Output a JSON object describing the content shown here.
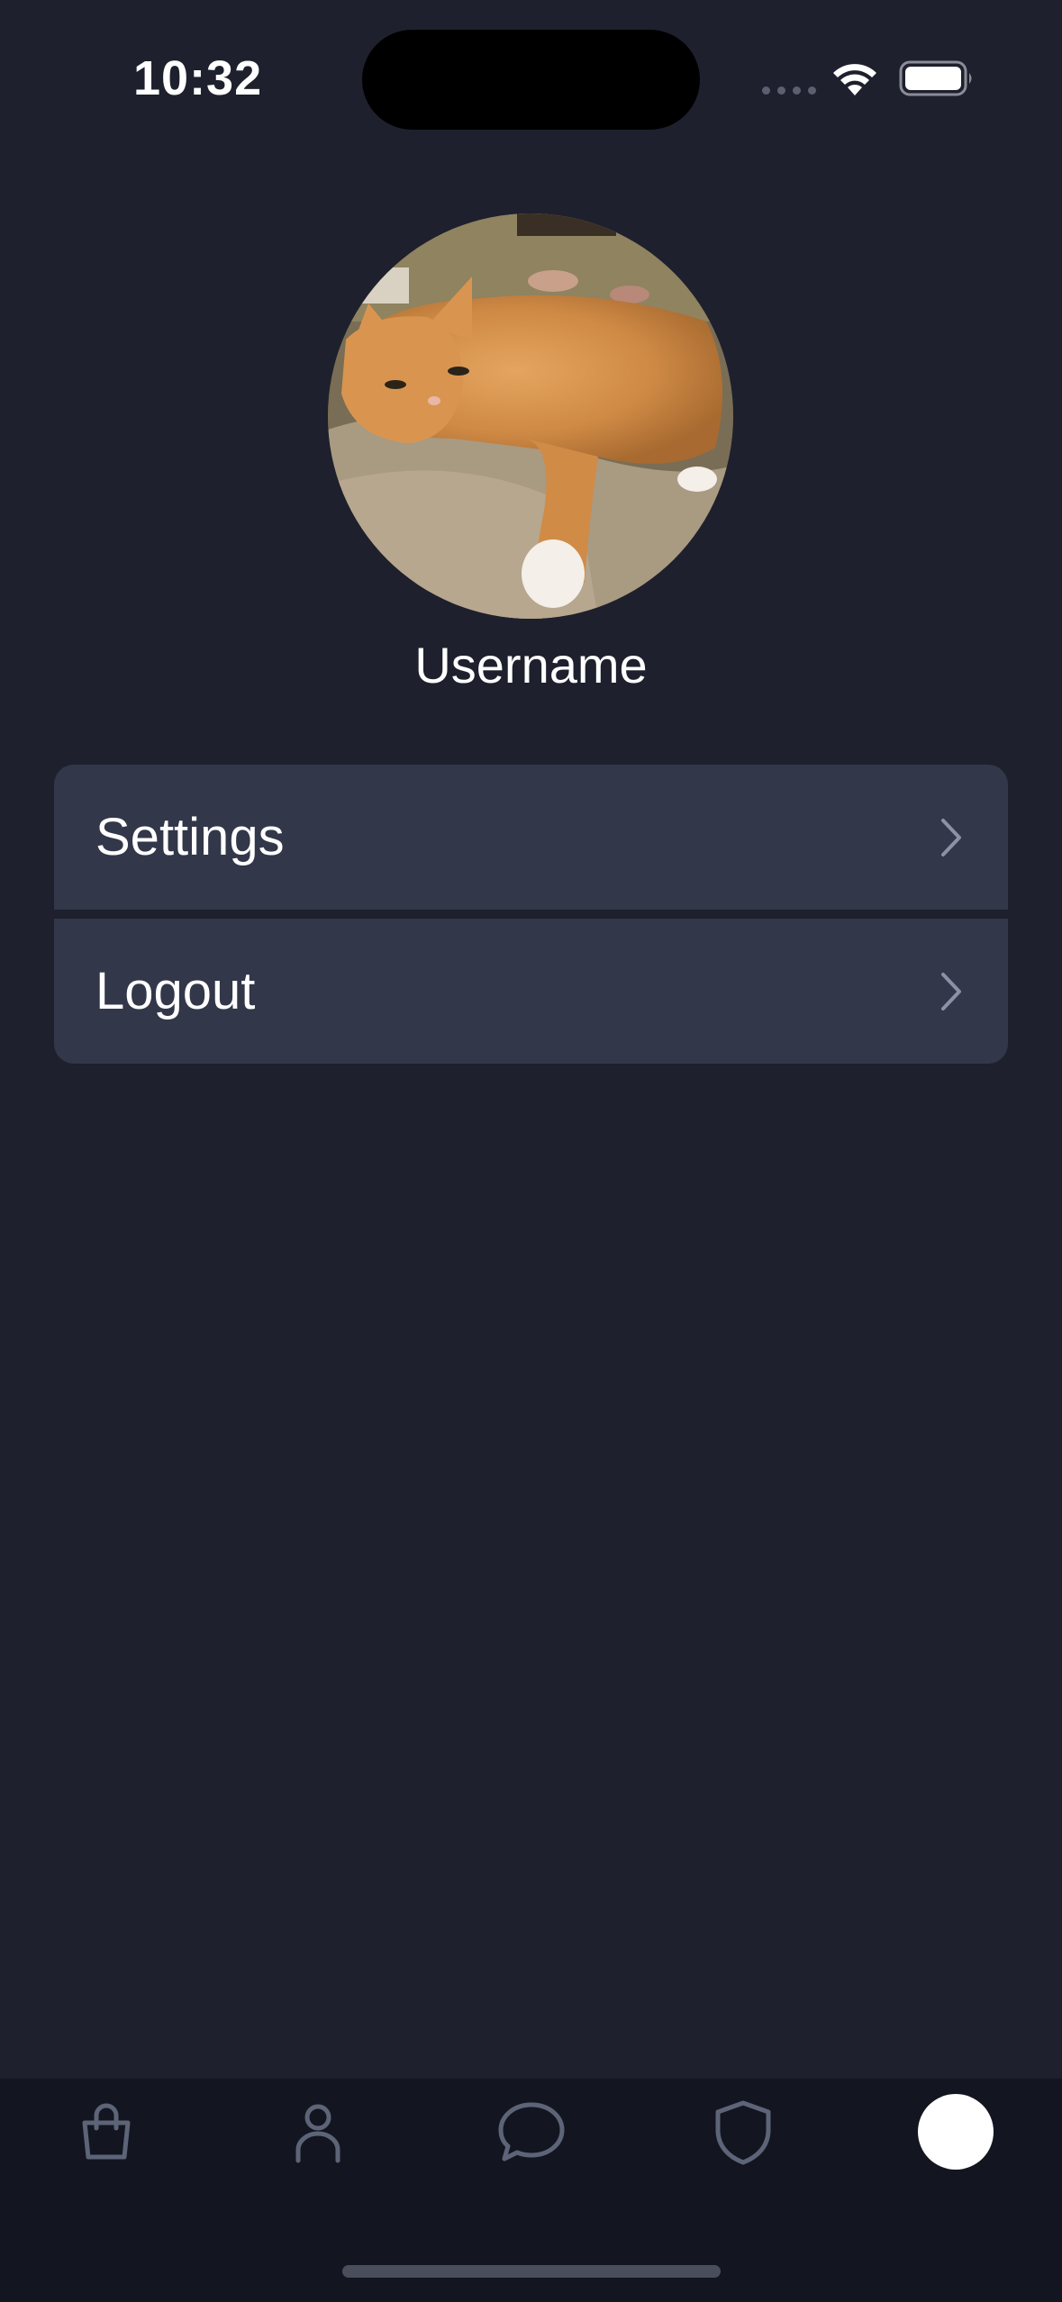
{
  "status_bar": {
    "time": "10:32"
  },
  "profile": {
    "username": "Username",
    "avatar_description": "photo of an orange cat"
  },
  "menu": {
    "items": [
      {
        "label": "Settings",
        "icon": "chevron-right-icon"
      },
      {
        "label": "Logout",
        "icon": "chevron-right-icon"
      }
    ]
  },
  "tab_bar": {
    "tabs": [
      {
        "icon": "shopping-bag-icon",
        "active": false
      },
      {
        "icon": "person-icon",
        "active": false
      },
      {
        "icon": "chat-bubble-icon",
        "active": false
      },
      {
        "icon": "shield-icon",
        "active": false
      },
      {
        "icon": "profile-dot-icon",
        "active": true
      }
    ]
  },
  "colors": {
    "background": "#1e202d",
    "card": "#323749",
    "tab_bar": "#131620",
    "icon_muted": "#5e6478",
    "text": "#ffffff"
  }
}
